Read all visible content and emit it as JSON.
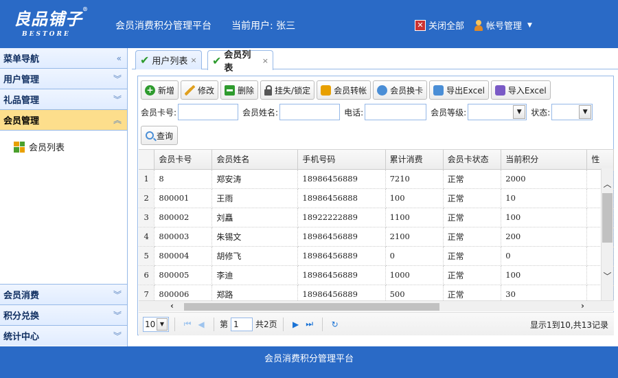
{
  "header": {
    "logo_text": "良品铺子",
    "logo_reg": "®",
    "logo_sub": "BESTORE",
    "app_title": "会员消费积分管理平台",
    "current_user": "当前用户: 张三",
    "close_all": "关闭全部",
    "account": "帐号管理"
  },
  "sidebar": {
    "nav_title": "菜单导航",
    "sections_top": [
      {
        "label": "用户管理"
      },
      {
        "label": "礼品管理"
      },
      {
        "label": "会员管理"
      }
    ],
    "tree_items": [
      {
        "label": "会员列表"
      }
    ],
    "sections_bottom": [
      {
        "label": "会员消费"
      },
      {
        "label": "积分兑换"
      },
      {
        "label": "统计中心"
      }
    ]
  },
  "tabs": [
    {
      "label": "用户列表",
      "active": false
    },
    {
      "label": "会员列表",
      "active": true
    }
  ],
  "toolbar": {
    "add": "新增",
    "edit": "修改",
    "delete": "删除",
    "lock": "挂失/锁定",
    "transfer": "会员转帐",
    "swap_card": "会员换卡",
    "export": "导出Excel",
    "import": "导入Excel"
  },
  "filters": {
    "card_no": "会员卡号:",
    "name": "会员姓名:",
    "phone": "电话:",
    "level": "会员等级:",
    "status": "状态:",
    "query": "查询"
  },
  "grid": {
    "columns": [
      "会员卡号",
      "会员姓名",
      "手机号码",
      "累计消费",
      "会员卡状态",
      "当前积分",
      "性"
    ],
    "rows": [
      {
        "n": "1",
        "card": "8",
        "name": "郑安涛",
        "phone": "18986456889",
        "spend": "7210",
        "status": "正常",
        "points": "2000"
      },
      {
        "n": "2",
        "card": "800001",
        "name": "王雨",
        "phone": "18986456888",
        "spend": "100",
        "status": "正常",
        "points": "10"
      },
      {
        "n": "3",
        "card": "800002",
        "name": "刘矗",
        "phone": "18922222889",
        "spend": "1100",
        "status": "正常",
        "points": "100"
      },
      {
        "n": "4",
        "card": "800003",
        "name": "朱锡文",
        "phone": "18986456889",
        "spend": "2100",
        "status": "正常",
        "points": "200"
      },
      {
        "n": "5",
        "card": "800004",
        "name": "胡修飞",
        "phone": "18986456889",
        "spend": "0",
        "status": "正常",
        "points": "0"
      },
      {
        "n": "6",
        "card": "800005",
        "name": "李迪",
        "phone": "18986456889",
        "spend": "1000",
        "status": "正常",
        "points": "100"
      },
      {
        "n": "7",
        "card": "800006",
        "name": "郑路",
        "phone": "18986456889",
        "spend": "500",
        "status": "正常",
        "points": "30"
      }
    ]
  },
  "pager": {
    "page_size": "10",
    "page_label": "第",
    "page_value": "1",
    "total_pages": "共2页",
    "info": "显示1到10,共13记录"
  },
  "footer": {
    "text": "会员消费积分管理平台"
  }
}
